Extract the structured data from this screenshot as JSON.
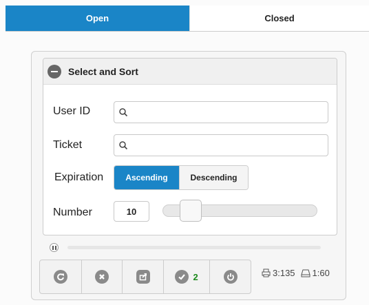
{
  "tabs": [
    {
      "label": "Open",
      "active": true
    },
    {
      "label": "Closed",
      "active": false
    }
  ],
  "panel": {
    "title": "Select and Sort",
    "toggle_icon": "minus-circle-icon"
  },
  "fields": {
    "user_id": {
      "label": "User ID",
      "value": "",
      "icon": "search-icon"
    },
    "ticket": {
      "label": "Ticket",
      "value": "",
      "icon": "search-icon"
    }
  },
  "expiration": {
    "label": "Expiration",
    "options": [
      "Ascending",
      "Descending"
    ],
    "selected": "Ascending"
  },
  "number": {
    "label": "Number",
    "value": "10",
    "slider_fraction": 0.1
  },
  "toolbar": {
    "buttons": [
      "refresh-icon",
      "close-circle-icon",
      "export-icon",
      "check-circle-icon",
      "power-icon"
    ],
    "check_count": "2"
  },
  "stats": {
    "printer": "3:135",
    "drive": "1:60"
  },
  "colors": {
    "accent": "#1a85c7",
    "badge": "#1c8a1c"
  }
}
